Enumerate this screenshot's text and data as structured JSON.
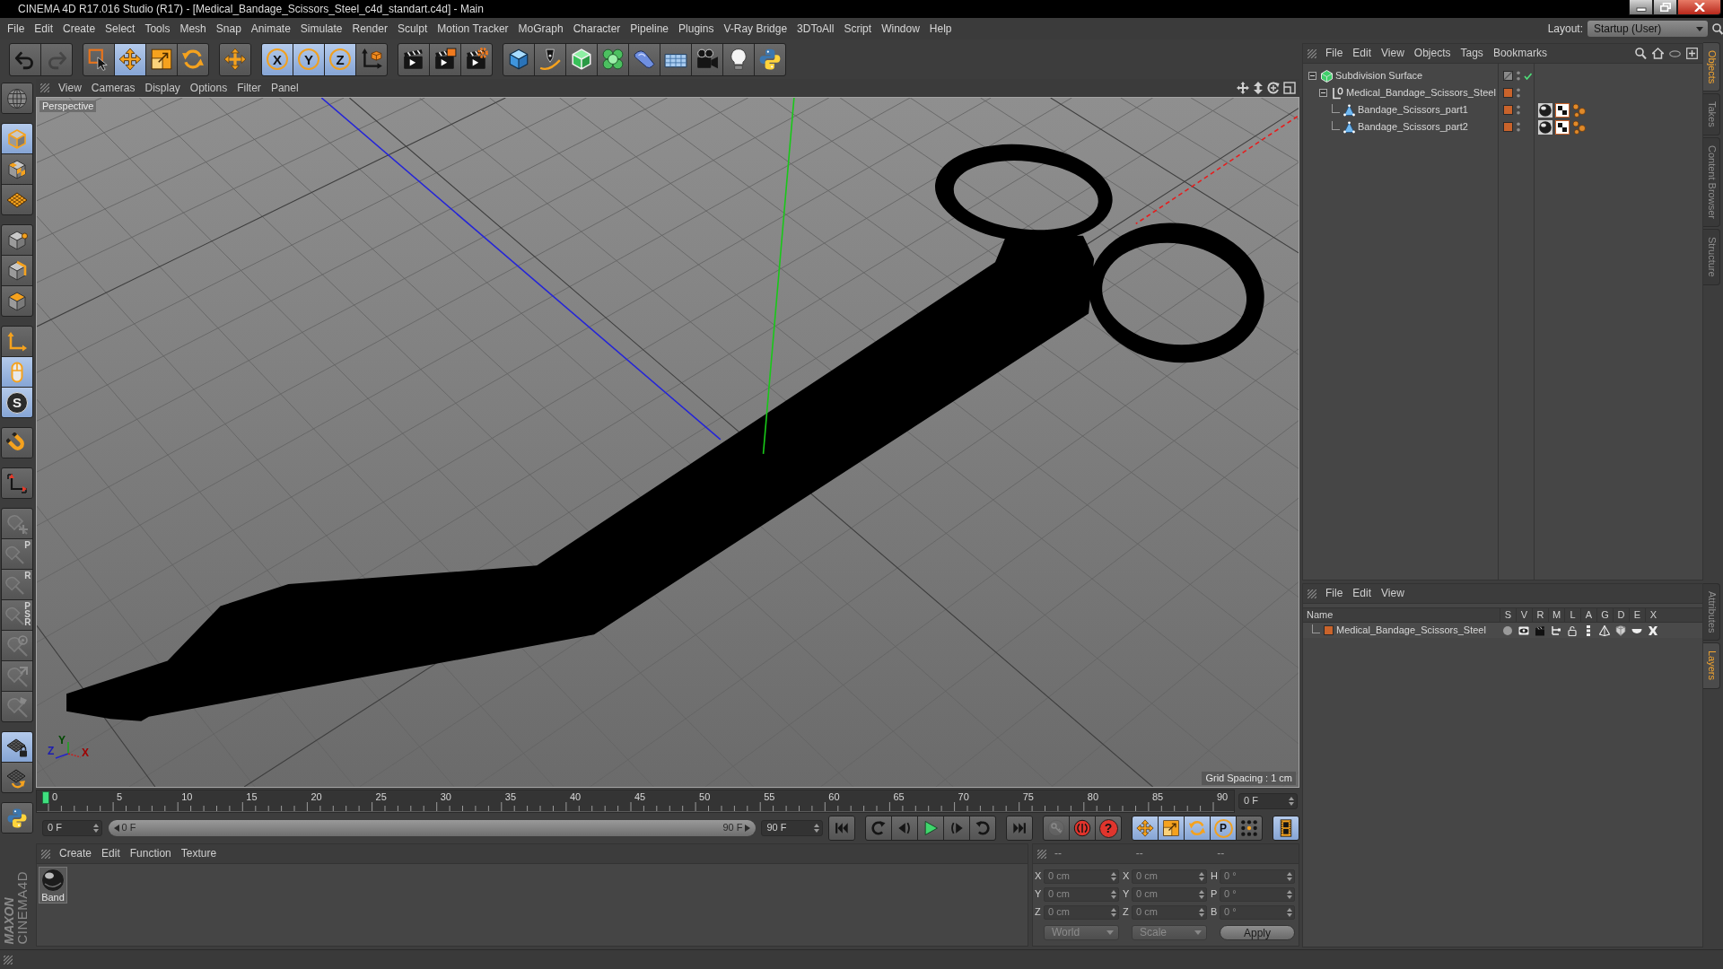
{
  "window": {
    "title": "CINEMA 4D R17.016 Studio (R17) - [Medical_Bandage_Scissors_Steel_c4d_standart.c4d] - Main"
  },
  "menu_bar": {
    "items": [
      "File",
      "Edit",
      "Create",
      "Select",
      "Tools",
      "Mesh",
      "Snap",
      "Animate",
      "Simulate",
      "Render",
      "Sculpt",
      "Motion Tracker",
      "MoGraph",
      "Character",
      "Pipeline",
      "Plugins",
      "V-Ray Bridge",
      "3DToAll",
      "Script",
      "Window",
      "Help"
    ],
    "layout_label": "Layout:",
    "layout_value": "Startup (User)"
  },
  "toolbar": {
    "groups": [
      {
        "tools": [
          {
            "kind": "undo",
            "selected": false,
            "disabled": false
          },
          {
            "kind": "redo",
            "selected": false,
            "disabled": true
          }
        ]
      },
      {
        "tools": [
          {
            "kind": "select",
            "selected": false,
            "disabled": false
          },
          {
            "kind": "move",
            "selected": true,
            "disabled": false
          },
          {
            "kind": "scale",
            "selected": false,
            "disabled": false
          },
          {
            "kind": "rotate",
            "selected": false,
            "disabled": false
          }
        ]
      },
      {
        "tools": [
          {
            "kind": "recent",
            "selected": false,
            "disabled": false
          }
        ]
      },
      {
        "tools": [
          {
            "kind": "axislock",
            "label": "X",
            "selected": true,
            "disabled": false
          },
          {
            "kind": "axislock",
            "label": "Y",
            "selected": true,
            "disabled": false
          },
          {
            "kind": "axislock",
            "label": "Z",
            "selected": true,
            "disabled": false
          },
          {
            "kind": "coordsys",
            "selected": false,
            "disabled": false
          }
        ]
      },
      {
        "tools": [
          {
            "kind": "renderview",
            "selected": false,
            "disabled": false
          },
          {
            "kind": "renderpicture",
            "selected": false,
            "disabled": false
          },
          {
            "kind": "rendersettings",
            "selected": false,
            "disabled": false
          }
        ]
      },
      {
        "tools": [
          {
            "kind": "cube",
            "selected": false,
            "disabled": false
          },
          {
            "kind": "pen",
            "selected": false,
            "disabled": false
          },
          {
            "kind": "subdivision",
            "selected": false,
            "disabled": false
          },
          {
            "kind": "cloner",
            "selected": false,
            "disabled": false
          },
          {
            "kind": "deformer",
            "selected": false,
            "disabled": false
          },
          {
            "kind": "floor",
            "selected": false,
            "disabled": false
          },
          {
            "kind": "camera",
            "selected": false,
            "disabled": false
          },
          {
            "kind": "light",
            "selected": false,
            "disabled": false
          },
          {
            "kind": "python",
            "selected": false,
            "disabled": false
          }
        ]
      }
    ]
  },
  "palette": {
    "groups": [
      {
        "tools": [
          {
            "kind": "editable",
            "selected": false,
            "disabled": false
          }
        ]
      },
      {
        "tools": [
          {
            "kind": "model",
            "selected": true,
            "disabled": false
          },
          {
            "kind": "texture",
            "selected": false,
            "disabled": false
          },
          {
            "kind": "workplane",
            "selected": false,
            "disabled": false
          }
        ]
      },
      {
        "tools": [
          {
            "kind": "points",
            "selected": false,
            "disabled": false
          },
          {
            "kind": "edges",
            "selected": false,
            "disabled": false
          },
          {
            "kind": "polygons",
            "selected": false,
            "disabled": false
          }
        ]
      },
      {
        "tools": [
          {
            "kind": "axis",
            "selected": false,
            "disabled": false
          },
          {
            "kind": "tweak",
            "selected": true,
            "disabled": false
          },
          {
            "kind": "snap",
            "label": "S",
            "selected": true,
            "disabled": false
          }
        ]
      },
      {
        "tools": [
          {
            "kind": "magnet",
            "selected": false,
            "disabled": false
          }
        ]
      },
      {
        "tools": [
          {
            "kind": "corner",
            "selected": false,
            "disabled": false
          }
        ]
      },
      {
        "tools": [
          {
            "kind": "pinplus",
            "selected": false,
            "disabled": true
          },
          {
            "kind": "pin",
            "label": "P",
            "selected": false,
            "disabled": true
          },
          {
            "kind": "pin",
            "label": "R",
            "selected": false,
            "disabled": true
          },
          {
            "kind": "pin",
            "label": "PSR",
            "selected": false,
            "disabled": true
          },
          {
            "kind": "target",
            "selected": false,
            "disabled": true
          },
          {
            "kind": "arrow",
            "selected": false,
            "disabled": true
          },
          {
            "kind": "brush",
            "selected": false,
            "disabled": true
          }
        ]
      },
      {
        "tools": [
          {
            "kind": "gridlock",
            "selected": true,
            "disabled": false
          },
          {
            "kind": "gridrotate",
            "selected": false,
            "disabled": false
          }
        ]
      },
      {
        "tools": [
          {
            "kind": "python",
            "selected": false,
            "disabled": false
          }
        ]
      }
    ]
  },
  "logo": {
    "brand": "MAXON",
    "product": "CINEMA4D"
  },
  "viewport": {
    "menus": [
      "View",
      "Cameras",
      "Display",
      "Options",
      "Filter",
      "Panel"
    ],
    "camera": "Perspective",
    "grid_spacing": "Grid Spacing : 1 cm",
    "gizmo_labels": [
      "Z",
      "Y",
      "X"
    ]
  },
  "timeline": {
    "ticks": [
      "0",
      "5",
      "10",
      "15",
      "20",
      "25",
      "30",
      "35",
      "40",
      "45",
      "50",
      "55",
      "60",
      "65",
      "70",
      "75",
      "80",
      "85",
      "90"
    ],
    "level": 0,
    "current_frame": "0 F"
  },
  "playback": {
    "start_frame": "0 F",
    "range_start": "0 F",
    "range_end": "90 F",
    "end_frame": "90 F",
    "groups": [
      {
        "tools": [
          {
            "kind": "first",
            "selected": false,
            "disabled": false
          }
        ]
      },
      {
        "tools": [
          {
            "kind": "prevkey",
            "selected": false,
            "disabled": false
          },
          {
            "kind": "prevframe",
            "selected": false,
            "disabled": false
          },
          {
            "kind": "play",
            "selected": false,
            "disabled": false
          },
          {
            "kind": "nextframe",
            "selected": false,
            "disabled": false
          },
          {
            "kind": "nextkey",
            "selected": false,
            "disabled": false
          }
        ]
      },
      {
        "tools": [
          {
            "kind": "last",
            "selected": false,
            "disabled": false
          }
        ]
      },
      {
        "tools": [
          {
            "kind": "key",
            "selected": false,
            "disabled": true
          },
          {
            "kind": "record",
            "selected": false,
            "disabled": false
          },
          {
            "kind": "autokey",
            "label": "?",
            "selected": false,
            "disabled": false
          }
        ]
      },
      {
        "tools": [
          {
            "kind": "keymove",
            "selected": true,
            "disabled": false
          },
          {
            "kind": "keyscale",
            "selected": true,
            "disabled": false
          },
          {
            "kind": "keyrotate",
            "selected": true,
            "disabled": false
          },
          {
            "kind": "param",
            "label": "P",
            "selected": true,
            "disabled": false
          },
          {
            "kind": "dots",
            "selected": false,
            "disabled": false
          }
        ]
      },
      {
        "tools": [
          {
            "kind": "film",
            "selected": true,
            "disabled": false
          }
        ]
      }
    ]
  },
  "material_manager": {
    "menus": [
      "Create",
      "Edit",
      "Function",
      "Texture"
    ],
    "materials": [
      {
        "name": "Band"
      }
    ]
  },
  "coordinates": {
    "headers": [
      "--",
      "--",
      "--"
    ],
    "groups": [
      {
        "fields": [
          {
            "axis": "X",
            "value": "0 cm"
          },
          {
            "axis": "Y",
            "value": "0 cm"
          },
          {
            "axis": "Z",
            "value": "0 cm"
          }
        ]
      },
      {
        "fields": [
          {
            "axis": "X",
            "value": "0 cm"
          },
          {
            "axis": "Y",
            "value": "0 cm"
          },
          {
            "axis": "Z",
            "value": "0 cm"
          }
        ]
      },
      {
        "fields": [
          {
            "axis": "H",
            "value": "0 °"
          },
          {
            "axis": "P",
            "value": "0 °"
          },
          {
            "axis": "B",
            "value": "0 °"
          }
        ]
      }
    ],
    "space": "World",
    "mode": "Scale",
    "apply": "Apply"
  },
  "object_manager": {
    "menus": [
      "File",
      "Edit",
      "View",
      "Objects",
      "Tags",
      "Bookmarks"
    ],
    "objects": [
      {
        "name": "Subdivision Surface",
        "kind": "subdivision",
        "expanded": true,
        "enabled": true,
        "children": [
          {
            "name": "Medical_Bandage_Scissors_Steel",
            "kind": "null",
            "color": "#c9632b",
            "expanded": true,
            "children": [
              {
                "name": "Bandage_Scissors_part1",
                "kind": "polygon",
                "color": "#c9632b",
                "tags": [
                  {
                    "kind": "material"
                  },
                  {
                    "kind": "uvw"
                  },
                  {
                    "kind": "phong"
                  }
                ]
              },
              {
                "name": "Bandage_Scissors_part2",
                "kind": "polygon",
                "color": "#c9632b",
                "tags": [
                  {
                    "kind": "material"
                  },
                  {
                    "kind": "uvw"
                  },
                  {
                    "kind": "phong"
                  }
                ]
              }
            ]
          }
        ]
      }
    ]
  },
  "layer_manager": {
    "menus": [
      "File",
      "Edit",
      "View"
    ],
    "columns": [
      "Name",
      "S",
      "V",
      "R",
      "M",
      "L",
      "A",
      "G",
      "D",
      "E",
      "X"
    ],
    "layers": [
      {
        "name": "Medical_Bandage_Scissors_Steel",
        "color": "#c9632b"
      }
    ]
  },
  "side_tabs": {
    "upper": [
      {
        "label": "Objects",
        "selected": true
      },
      {
        "label": "Takes",
        "selected": false
      },
      {
        "label": "Content Browser",
        "selected": false
      },
      {
        "label": "Structure",
        "selected": false
      }
    ],
    "lower": [
      {
        "label": "Attributes",
        "selected": false
      },
      {
        "label": "Layers",
        "selected": true
      }
    ]
  }
}
